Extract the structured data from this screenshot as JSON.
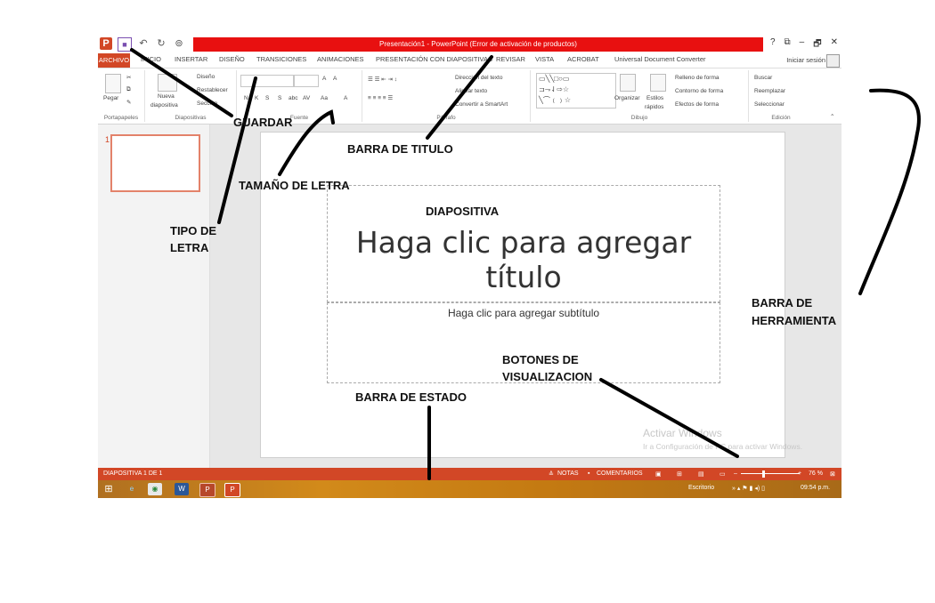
{
  "window": {
    "title": "Presentación1 - PowerPoint (Error de activación de productos)",
    "controls": [
      "?",
      "⧉",
      "–",
      "🗗",
      "✕"
    ]
  },
  "tabs": {
    "file": "ARCHIVO",
    "items": [
      "INICIO",
      "INSERTAR",
      "DISEÑO",
      "TRANSICIONES",
      "ANIMACIONES",
      "PRESENTACIÓN CON DIAPOSITIVAS",
      "REVISAR",
      "VISTA",
      "ACROBAT",
      "Universal Document Converter"
    ],
    "signin": "Iniciar sesión"
  },
  "ribbon": {
    "clipboard": {
      "paste": "Pegar",
      "label": "Portapapeles"
    },
    "slides": {
      "new_slide_1": "Nueva",
      "new_slide_2": "diapositiva",
      "layout": "Diseño",
      "reset": "Restablecer",
      "section": "Sección",
      "label": "Diapositivas"
    },
    "font": {
      "bold": "N",
      "italic": "K",
      "underline": "S",
      "shadow": "S",
      "strike": "abc",
      "spacing": "AV",
      "case": "Aa",
      "grow": "A",
      "shrink": "A",
      "color": "A",
      "label": "Fuente"
    },
    "paragraph": {
      "direction": "Dirección del texto",
      "align": "Alinear texto",
      "smartart": "Convertir a SmartArt",
      "label": "Párrafo"
    },
    "drawing": {
      "arrange": "Organizar",
      "styles_1": "Estilos",
      "styles_2": "rápidos",
      "fill": "Relleno de forma",
      "outline": "Contorno de forma",
      "effects": "Efectos de forma",
      "label": "Dibujo"
    },
    "editing": {
      "find": "Buscar",
      "replace": "Reemplazar",
      "select": "Seleccionar",
      "label": "Edición"
    }
  },
  "slide_pane": {
    "number": "1"
  },
  "slide": {
    "title_placeholder": "Haga clic para agregar título",
    "subtitle_placeholder": "Haga clic para agregar subtítulo"
  },
  "watermark": {
    "line1": "Activar Windows",
    "line2": "Ir a Configuración de PC para activar Windows."
  },
  "statusbar": {
    "slide_info": "DIAPOSITIVA 1 DE 1",
    "notes": "NOTAS",
    "comments": "COMENTARIOS",
    "zoom": "76 %"
  },
  "taskbar": {
    "desktop": "Escritorio",
    "time": "09:54 p.m."
  },
  "annotations": {
    "guardar": "GUARDAR",
    "barra_titulo": "BARRA DE TITULO",
    "tamano_letra": "TAMAÑO DE LETRA",
    "diapositiva": "DIAPOSITIVA",
    "tipo_letra_1": "TIPO DE",
    "tipo_letra_2": "LETRA",
    "barra_herramienta_1": "BARRA DE",
    "barra_herramienta_2": "HERRAMIENTA",
    "botones_1": "BOTONES DE",
    "botones_2": "VISUALIZACION",
    "barra_estado": "BARRA DE ESTADO"
  },
  "colors": {
    "accent": "#d24726",
    "title_error": "#e81010",
    "annotation": "#111111"
  }
}
